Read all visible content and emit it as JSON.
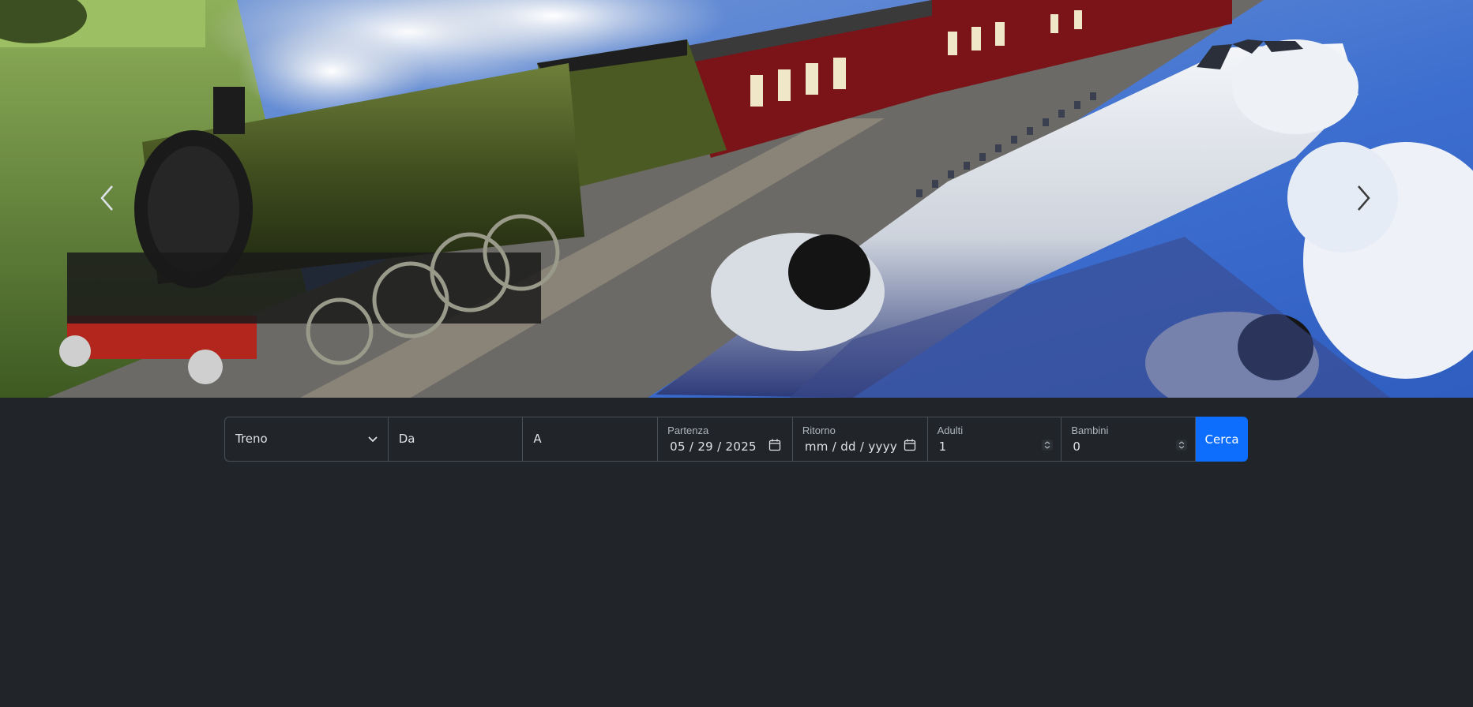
{
  "search": {
    "transport_select": {
      "selected": "Treno",
      "options": [
        "Treno"
      ]
    },
    "from_input": {
      "placeholder": "Da",
      "value": ""
    },
    "to_input": {
      "placeholder": "A",
      "value": ""
    },
    "departure": {
      "label": "Partenza",
      "value": "05 / 29 / 2025"
    },
    "return": {
      "label": "Ritorno",
      "value": "mm / dd / yyyy"
    },
    "adults": {
      "label": "Adulti",
      "value": "1"
    },
    "children": {
      "label": "Bambini",
      "value": "0"
    },
    "submit_label": "Cerca"
  },
  "theme": {
    "background": "#212529",
    "accent": "#0d6efd",
    "border": "#495057",
    "text": "#dee2e6",
    "label": "#adb5bd"
  },
  "icons": {
    "prev": "chevron-left-icon",
    "next": "chevron-right-icon",
    "select": "chevron-down-icon",
    "date": "calendar-icon",
    "spinner": "spinner-arrows-icon"
  }
}
